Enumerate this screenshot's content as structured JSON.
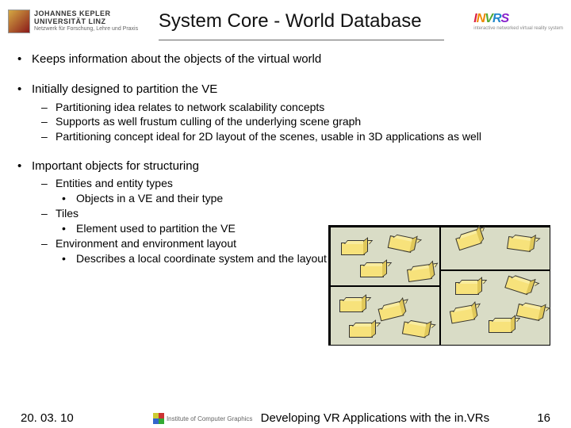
{
  "header": {
    "logo_left_line1": "JOHANNES KEPLER",
    "logo_left_line2": "UNIVERSITÄT LINZ",
    "logo_left_sub": "Netzwerk für Forschung, Lehre und Praxis",
    "title": "System Core - World Database",
    "logo_right": "INVRS",
    "logo_right_sub": "interactive networked virtual reality system"
  },
  "bullets": {
    "b1": "Keeps information about the objects of the virtual world",
    "b2": "Initially designed to partition the VE",
    "b2s1": "Partitioning idea relates to network scalability concepts",
    "b2s2": "Supports as well frustum culling of the underlying scene graph",
    "b2s3": "Partitioning concept ideal for 2D layout of the scenes, usable in 3D applications as well",
    "b3": "Important objects for structuring",
    "b3s1": "Entities and entity types",
    "b3s1a": "Objects in a VE and their type",
    "b3s2": "Tiles",
    "b3s2a": "Element used to partition the VE",
    "b3s3": "Environment and environment layout",
    "b3s3a": "Describes a local coordinate system and the layout of several coordinate systems"
  },
  "footer": {
    "date": "20. 03. 10",
    "cg_label": "Institute of Computer Graphics",
    "center": "Developing VR Applications with the in.VRs",
    "page": "16"
  }
}
